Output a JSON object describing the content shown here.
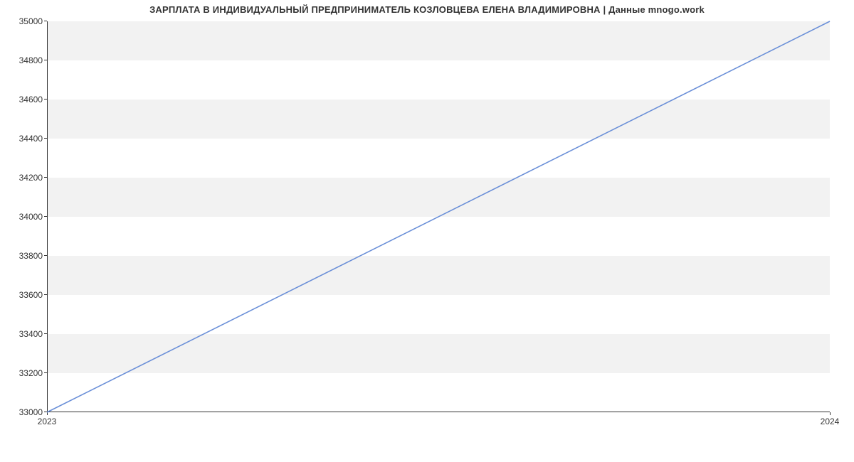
{
  "chart_data": {
    "type": "line",
    "title": "ЗАРПЛАТА В ИНДИВИДУАЛЬНЫЙ ПРЕДПРИНИМАТЕЛЬ КОЗЛОВЦЕВА ЕЛЕНА ВЛАДИМИРОВНА | Данные mnogo.work",
    "xlabel": "",
    "ylabel": "",
    "x_categories": [
      "2023",
      "2024"
    ],
    "y_ticks": [
      33000,
      33200,
      33400,
      33600,
      33800,
      34000,
      34200,
      34400,
      34600,
      34800,
      35000
    ],
    "ylim": [
      33000,
      35000
    ],
    "series": [
      {
        "name": "salary",
        "x": [
          "2023",
          "2024"
        ],
        "values": [
          33000,
          35000
        ],
        "color": "#6a8fd8"
      }
    ],
    "grid": {
      "bands": true
    }
  },
  "labels": {
    "title": "ЗАРПЛАТА В ИНДИВИДУАЛЬНЫЙ ПРЕДПРИНИМАТЕЛЬ КОЗЛОВЦЕВА ЕЛЕНА ВЛАДИМИРОВНА | Данные mnogo.work",
    "y": {
      "t33000": "33000",
      "t33200": "33200",
      "t33400": "33400",
      "t33600": "33600",
      "t33800": "33800",
      "t34000": "34000",
      "t34200": "34200",
      "t34400": "34400",
      "t34600": "34600",
      "t34800": "34800",
      "t35000": "35000"
    },
    "x": {
      "x0": "2023",
      "x1": "2024"
    }
  }
}
